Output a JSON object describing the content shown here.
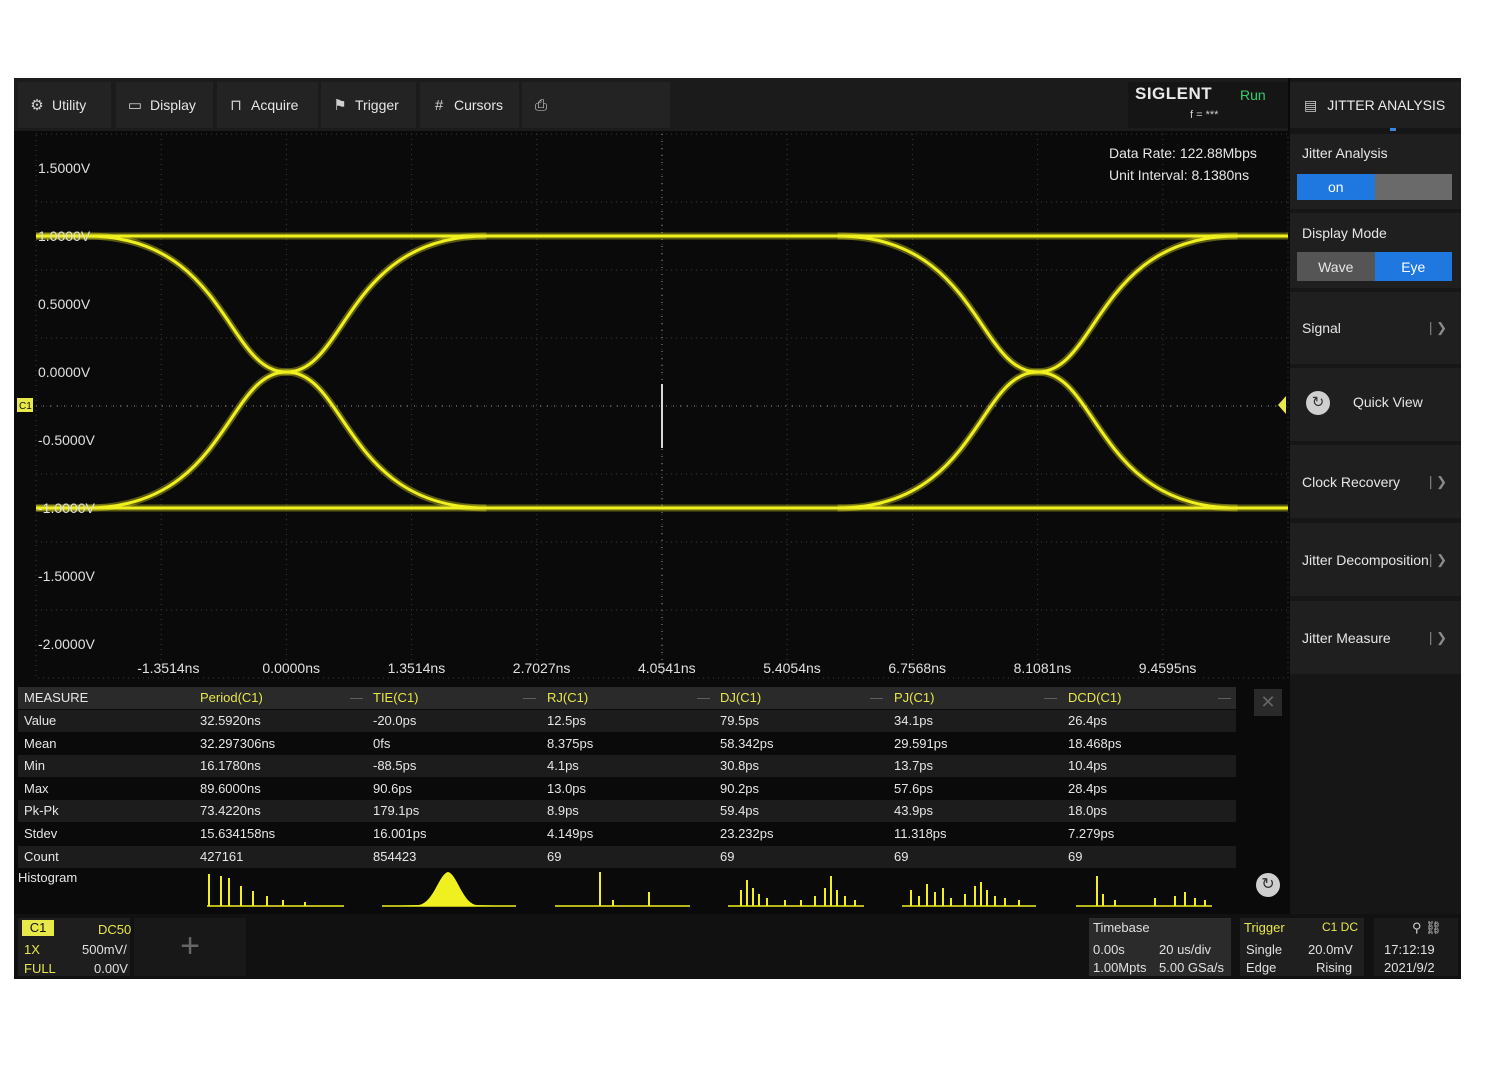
{
  "toolbar": {
    "items": [
      {
        "label": "Utility",
        "icon": "gear-icon"
      },
      {
        "label": "Display",
        "icon": "monitor-icon"
      },
      {
        "label": "Acquire",
        "icon": "acquire-icon"
      },
      {
        "label": "Trigger",
        "icon": "flag-icon"
      },
      {
        "label": "Cursors",
        "icon": "cursors-icon"
      }
    ],
    "screenshot_icon": "screenshot-icon"
  },
  "brand": {
    "logo": "SIGLENT",
    "run_state": "Run",
    "frequency": "f = ***"
  },
  "right_panel": {
    "title": "JITTER ANALYSIS",
    "jitter_analysis": {
      "label": "Jitter Analysis",
      "on": "on",
      "off": ""
    },
    "display_mode": {
      "label": "Display Mode",
      "options": [
        "Wave",
        "Eye"
      ],
      "selected": "Eye"
    },
    "signal": "Signal",
    "quick_view": "Quick View",
    "clock_recovery": "Clock Recovery",
    "jitter_decomposition": "Jitter Decomposition",
    "jitter_measure": "Jitter Measure"
  },
  "display": {
    "data_rate": "Data Rate: 122.88Mbps",
    "unit_interval": "Unit Interval: 8.1380ns",
    "voltage_labels": [
      "1.5000V",
      "1.0000V",
      "0.5000V",
      "0.0000V",
      "-0.5000V",
      "-1.0000V",
      "-1.5000V",
      "-2.0000V"
    ],
    "time_labels": [
      "-1.3514ns",
      "0.0000ns",
      "1.3514ns",
      "2.7027ns",
      "4.0541ns",
      "5.4054ns",
      "6.7568ns",
      "8.1081ns",
      "9.4595ns"
    ],
    "channel_marker": "C1",
    "trace_color": "#f0f020"
  },
  "measure": {
    "header": [
      "MEASURE",
      "Period(C1)",
      "TIE(C1)",
      "RJ(C1)",
      "DJ(C1)",
      "PJ(C1)",
      "DCD(C1)"
    ],
    "rows": [
      [
        "Value",
        "32.5920ns",
        "-20.0ps",
        "12.5ps",
        "79.5ps",
        "34.1ps",
        "26.4ps"
      ],
      [
        "Mean",
        "32.297306ns",
        "0fs",
        "8.375ps",
        "58.342ps",
        "29.591ps",
        "18.468ps"
      ],
      [
        "Min",
        "16.1780ns",
        "-88.5ps",
        "4.1ps",
        "30.8ps",
        "13.7ps",
        "10.4ps"
      ],
      [
        "Max",
        "89.6000ns",
        "90.6ps",
        "13.0ps",
        "90.2ps",
        "57.6ps",
        "28.4ps"
      ],
      [
        "Pk-Pk",
        "73.4220ns",
        "179.1ps",
        "8.9ps",
        "59.4ps",
        "43.9ps",
        "18.0ps"
      ],
      [
        "Stdev",
        "15.634158ns",
        "16.001ps",
        "4.149ps",
        "23.232ps",
        "11.318ps",
        "7.279ps"
      ],
      [
        "Count",
        "427161",
        "854423",
        "69",
        "69",
        "69",
        "69"
      ]
    ],
    "histogram_label": "Histogram"
  },
  "channel": {
    "name": "C1",
    "coupling": "DC50",
    "probe": "1X",
    "scale": "500mV/",
    "bandwidth": "FULL",
    "offset": "0.00V"
  },
  "timebase": {
    "label": "Timebase",
    "delay": "0.00s",
    "scale": "20 us/div",
    "memory": "1.00Mpts",
    "sample_rate": "5.00 GSa/s"
  },
  "trigger": {
    "label": "Trigger",
    "source": "C1 DC",
    "mode": "Single",
    "level": "20.0mV",
    "type": "Edge",
    "slope": "Rising"
  },
  "clock": {
    "time": "17:12:19",
    "date": "2021/9/2"
  }
}
